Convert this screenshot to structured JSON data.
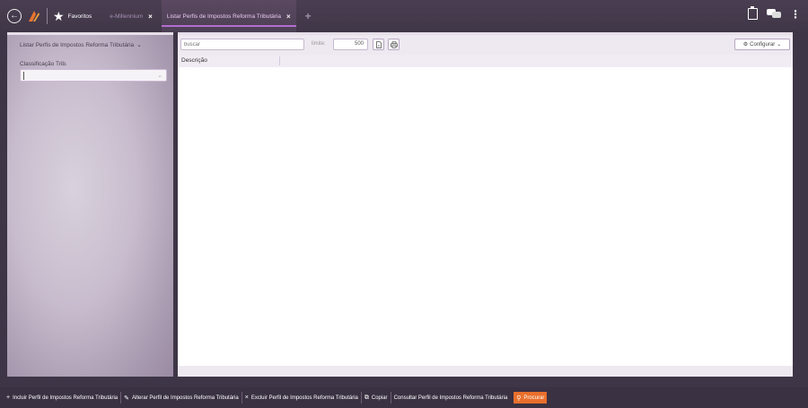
{
  "topbar": {
    "favorites_label": "Favoritos",
    "tabs": [
      {
        "label": "e-Millennium",
        "close": "×",
        "active": false
      },
      {
        "label": "Listar Perfis de Impostos Reforma Tributária",
        "close": "×",
        "active": true
      }
    ],
    "add_tab": "+",
    "more": "⋮"
  },
  "filter_panel": {
    "title": "Listar Perfis de Impostos Reforma Tributária",
    "field_label": "Classificação Trib.",
    "field_value": ""
  },
  "toolbar": {
    "search_placeholder": "buscar",
    "limit_label": "limite:",
    "limit_value": "500",
    "configure_label": "Configurar"
  },
  "table": {
    "columns": [
      "Descrição"
    ],
    "rows": []
  },
  "actions": [
    {
      "icon": "+",
      "label": "Incluir Perfil de Impostos Reforma Tributária"
    },
    {
      "icon": "✎",
      "label": "Alterar Perfil de Impostos Reforma Tributária"
    },
    {
      "icon": "×",
      "label": "Excluir Perfil de Impostos Reforma Tributária"
    },
    {
      "icon": "⧉",
      "label": "Copiar"
    },
    {
      "icon": "",
      "label": "Consultar Perfil de Impostos Reforma Tributária"
    },
    {
      "icon": "⚲",
      "label": "Procurar"
    }
  ],
  "colors": {
    "accent": "#b56dd0",
    "primary_action": "#e96f2c",
    "topbar_bg": "#4a3f52"
  }
}
